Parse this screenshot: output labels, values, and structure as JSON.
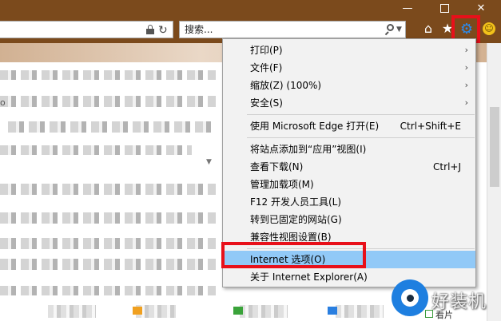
{
  "window": {
    "minimize_glyph": "—",
    "close_glyph": "✕"
  },
  "toolbar": {
    "search_placeholder": "搜索...",
    "icons": [
      "lock-icon",
      "refresh-icon",
      "search-icon",
      "home-icon",
      "star-icon",
      "gear-icon",
      "smiley-icon"
    ]
  },
  "tools_menu": {
    "items": [
      {
        "label": "打印(P)",
        "submenu": true
      },
      {
        "label": "文件(F)",
        "submenu": true
      },
      {
        "label": "缩放(Z) (100%)",
        "submenu": true
      },
      {
        "label": "安全(S)",
        "submenu": true
      },
      {
        "label": "使用 Microsoft Edge 打开(E)",
        "shortcut": "Ctrl+Shift+E"
      },
      {
        "label": "将站点添加到“应用”视图(I)"
      },
      {
        "label": "查看下载(N)",
        "shortcut": "Ctrl+J"
      },
      {
        "label": "管理加载项(M)"
      },
      {
        "label": "F12 开发人员工具(L)"
      },
      {
        "label": "转到已固定的网站(G)"
      },
      {
        "label": "兼容性视图设置(B)"
      },
      {
        "label": "Internet 选项(O)",
        "highlighted": true
      },
      {
        "label": "关于 Internet Explorer(A)"
      }
    ]
  },
  "page_fragments": {
    "left_text": "o"
  },
  "watermark": {
    "text": "好装机",
    "bottom_label": "看片"
  },
  "colors": {
    "titlebar": "#7b4a1c",
    "highlight": "#91c9f7",
    "callout_box": "#e8101a",
    "gear": "#2a8cf0"
  }
}
